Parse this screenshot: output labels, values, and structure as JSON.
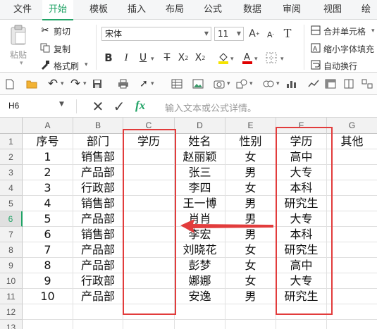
{
  "menu": {
    "tabs": [
      "文件",
      "开始",
      "模板",
      "插入",
      "布局",
      "公式",
      "数据",
      "审阅",
      "视图",
      "绘"
    ],
    "active_index": 1
  },
  "ribbon": {
    "paste_label": "粘贴",
    "cut_label": "剪切",
    "copy_label": "复制",
    "format_painter_label": "格式刷",
    "font_name": "宋体",
    "font_size": "11",
    "merge_label": "合并单元格",
    "shrink_label": "缩小字体填充",
    "wrap_label": "自动换行"
  },
  "formula_bar": {
    "cell_ref": "H6",
    "fx_label": "fx",
    "placeholder": "输入文本或公式详情。"
  },
  "grid": {
    "columns": [
      "A",
      "B",
      "C",
      "D",
      "E",
      "F",
      "G"
    ],
    "rows": [
      "1",
      "2",
      "3",
      "4",
      "5",
      "6",
      "7",
      "8",
      "9",
      "10",
      "11",
      "12",
      "13"
    ],
    "selected_row": "6",
    "cells": [
      [
        "序号",
        "部门",
        "学历",
        "姓名",
        "性别",
        "学历",
        "其他"
      ],
      [
        "1",
        "销售部",
        "",
        "赵丽颖",
        "女",
        "高中",
        ""
      ],
      [
        "2",
        "产品部",
        "",
        "张三",
        "男",
        "大专",
        ""
      ],
      [
        "3",
        "行政部",
        "",
        "李四",
        "女",
        "本科",
        ""
      ],
      [
        "4",
        "销售部",
        "",
        "王一博",
        "男",
        "研究生",
        ""
      ],
      [
        "5",
        "产品部",
        "",
        "肖肖",
        "男",
        "大专",
        ""
      ],
      [
        "6",
        "销售部",
        "",
        "李宏",
        "男",
        "本科",
        ""
      ],
      [
        "7",
        "产品部",
        "",
        "刘晓花",
        "女",
        "研究生",
        ""
      ],
      [
        "8",
        "产品部",
        "",
        "彭梦",
        "女",
        "高中",
        ""
      ],
      [
        "9",
        "行政部",
        "",
        "娜娜",
        "女",
        "大专",
        ""
      ],
      [
        "10",
        "产品部",
        "",
        "安逸",
        "男",
        "研究生",
        ""
      ]
    ]
  },
  "colors": {
    "accent": "#21a366",
    "annotation": "#e23c3c"
  }
}
